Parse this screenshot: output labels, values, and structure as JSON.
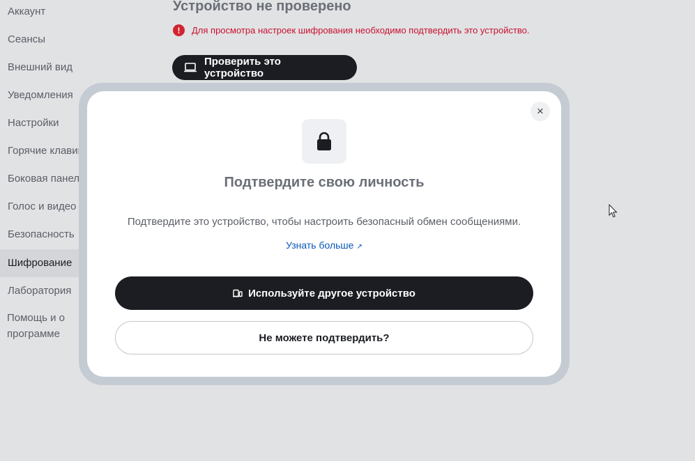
{
  "sidebar": {
    "items": [
      {
        "label": "Аккаунт"
      },
      {
        "label": "Сеансы"
      },
      {
        "label": "Внешний вид"
      },
      {
        "label": "Уведомления"
      },
      {
        "label": "Настройки"
      },
      {
        "label": "Горячие клавиши"
      },
      {
        "label": "Боковая панель"
      },
      {
        "label": "Голос и видео"
      },
      {
        "label": "Безопасность"
      },
      {
        "label": "Шифрование"
      },
      {
        "label": "Лаборатория"
      },
      {
        "label": "Помощь и о программе"
      }
    ],
    "active": "Шифрование"
  },
  "main": {
    "title": "Устройство не проверено",
    "warning": "Для просмотра настроек шифрования необходимо подтвердить это устройство.",
    "verify_button": "Проверить это устройство"
  },
  "dialog": {
    "close_label": "×",
    "icon": "lock-icon",
    "title": "Подтвердите свою личность",
    "description": "Подтвердите это устройство, чтобы настроить безопасный обмен сообщениями.",
    "learn_more": "Узнать больше",
    "primary_button": "Используйте другое устройство",
    "secondary_button": "Не можете подтвердить?"
  },
  "colors": {
    "accent_dark": "#1b1d22",
    "error": "#c8102e",
    "link": "#0b57b7"
  }
}
